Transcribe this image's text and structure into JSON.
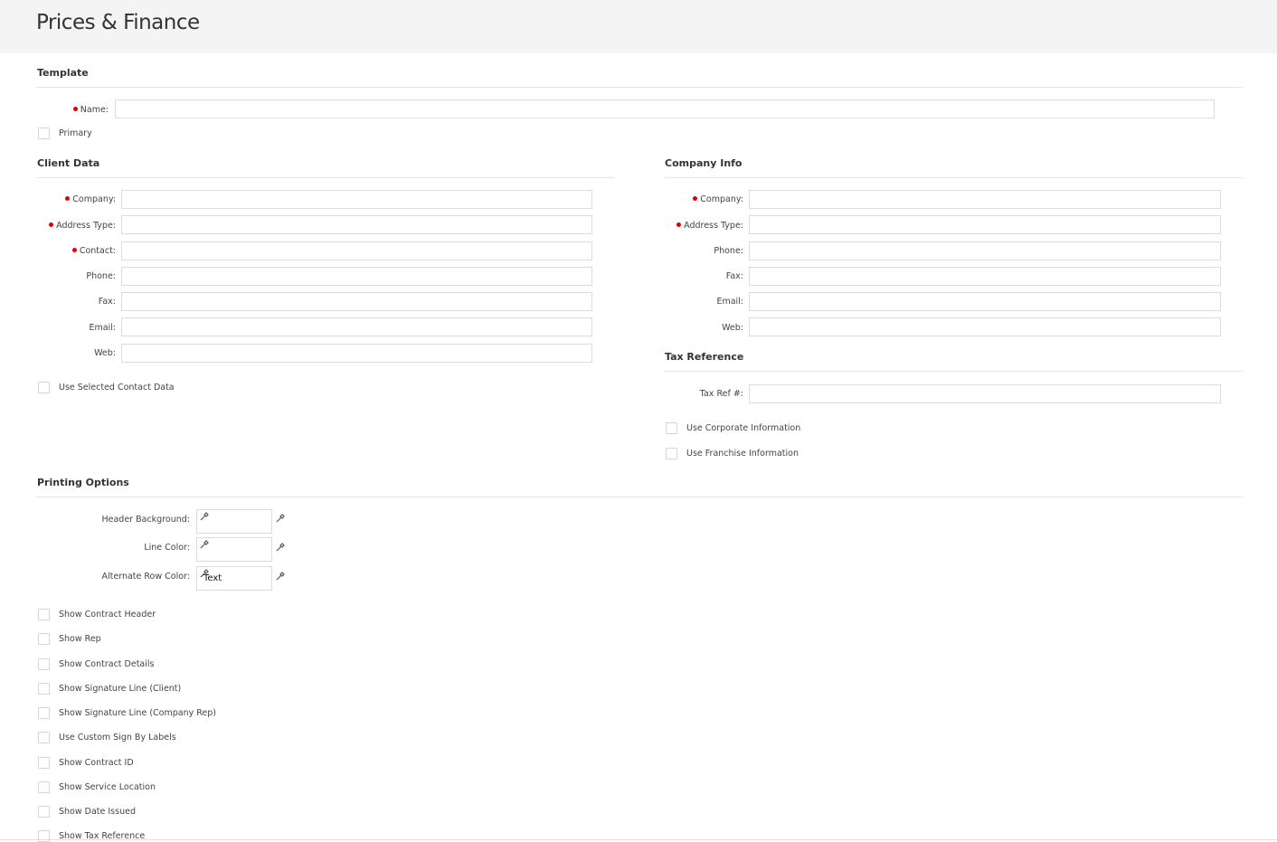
{
  "page": {
    "title": "Prices & Finance"
  },
  "template": {
    "title": "Template",
    "name_label": "Name:",
    "name_value": "",
    "primary_label": "Primary"
  },
  "client_data": {
    "title": "Client Data",
    "fields": {
      "company": {
        "label": "Company:",
        "required": true,
        "value": ""
      },
      "address_type": {
        "label": "Address Type:",
        "required": true,
        "value": ""
      },
      "contact": {
        "label": "Contact:",
        "required": true,
        "value": ""
      },
      "phone": {
        "label": "Phone:",
        "required": false,
        "value": ""
      },
      "fax": {
        "label": "Fax:",
        "required": false,
        "value": ""
      },
      "email": {
        "label": "Email:",
        "required": false,
        "value": ""
      },
      "web": {
        "label": "Web:",
        "required": false,
        "value": ""
      }
    },
    "use_selected_contact_label": "Use Selected Contact Data"
  },
  "company_info": {
    "title": "Company Info",
    "fields": {
      "company": {
        "label": "Company:",
        "required": true,
        "value": ""
      },
      "address_type": {
        "label": "Address Type:",
        "required": true,
        "value": ""
      },
      "phone": {
        "label": "Phone:",
        "required": false,
        "value": ""
      },
      "fax": {
        "label": "Fax:",
        "required": false,
        "value": ""
      },
      "email": {
        "label": "Email:",
        "required": false,
        "value": ""
      },
      "web": {
        "label": "Web:",
        "required": false,
        "value": ""
      }
    }
  },
  "tax_reference": {
    "title": "Tax Reference",
    "tax_ref_label": "Tax Ref #:",
    "tax_ref_value": "",
    "use_corporate_label": "Use Corporate Information",
    "use_franchise_label": "Use Franchise Information"
  },
  "printing_options": {
    "title": "Printing Options",
    "header_background_label": "Header Background:",
    "line_color_label": "Line Color:",
    "alternate_row_color_label": "Alternate Row Color:",
    "alternate_row_color_text": "Text",
    "checkboxes": {
      "show_contract_header": "Show Contract Header",
      "show_rep": "Show Rep",
      "show_contract_details": "Show Contract Details",
      "show_signature_client": "Show Signature Line (Client)",
      "show_signature_company_rep": "Show Signature Line (Company Rep)",
      "use_custom_sign_by_labels": "Use Custom Sign By Labels",
      "show_contract_id": "Show Contract ID",
      "show_service_location": "Show Service Location",
      "show_date_issued": "Show Date Issued",
      "show_tax_reference": "Show Tax Reference"
    }
  },
  "colors": {
    "required_marker": "#e00000",
    "topbar": "#f4f4f4"
  },
  "icons": {
    "color_picker": "eyedropper-icon"
  }
}
